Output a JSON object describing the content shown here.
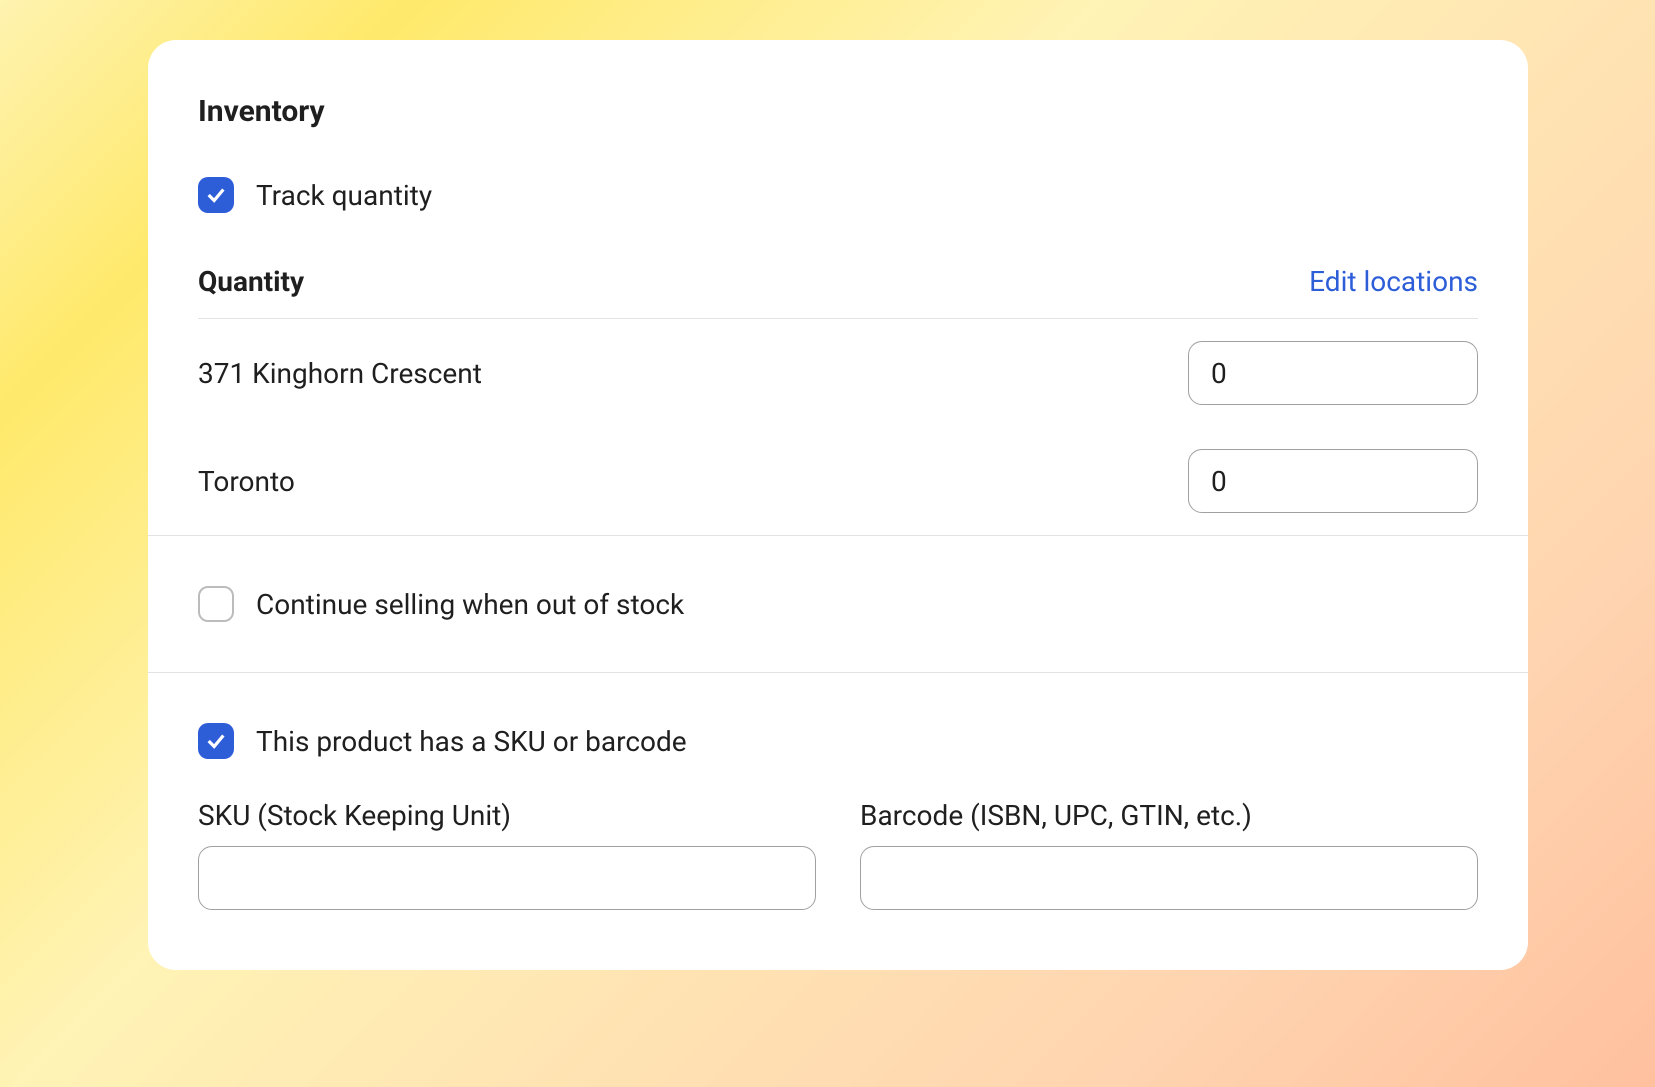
{
  "section": {
    "title": "Inventory",
    "track_quantity": {
      "label": "Track quantity",
      "checked": true
    },
    "quantity": {
      "title": "Quantity",
      "edit_link": "Edit locations",
      "locations": [
        {
          "name": "371 Kinghorn Crescent",
          "value": "0"
        },
        {
          "name": "Toronto",
          "value": "0"
        }
      ]
    },
    "continue_selling": {
      "label": "Continue selling when out of stock",
      "checked": false
    },
    "sku_section": {
      "has_sku_label": "This product has a SKU or barcode",
      "has_sku_checked": true,
      "sku_label": "SKU (Stock Keeping Unit)",
      "sku_value": "",
      "barcode_label": "Barcode (ISBN, UPC, GTIN, etc.)",
      "barcode_value": ""
    }
  }
}
